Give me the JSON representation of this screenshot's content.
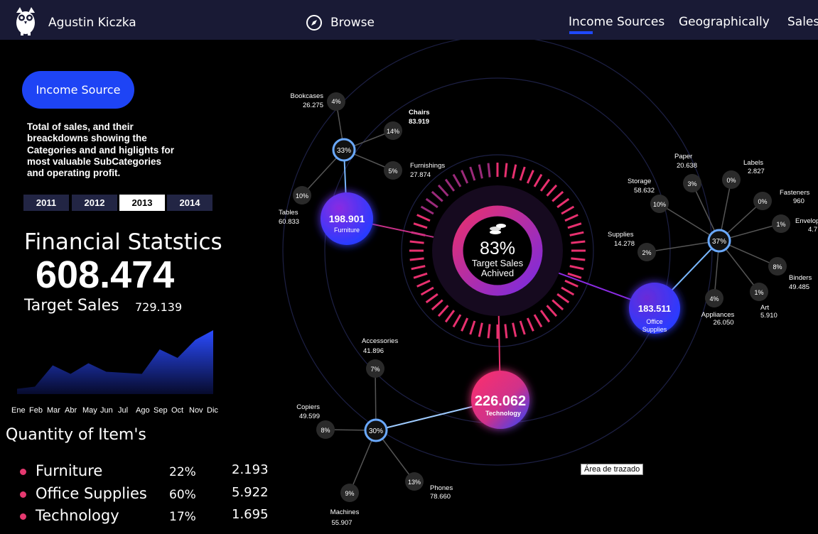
{
  "header": {
    "user_name": "Agustin Kiczka",
    "browse_label": "Browse",
    "nav": [
      {
        "label": "Income Sources",
        "active": true
      },
      {
        "label": "Geographically",
        "active": false
      },
      {
        "label": "Sales",
        "active": false
      }
    ]
  },
  "sidebar": {
    "pill_label": "Income Source",
    "description": "Total of sales, and their\nbreackdowns showing the\nCategories and and higlights for\nmost valuable SubCategories\nand operating profit.",
    "years": [
      {
        "label": "2011",
        "active": false
      },
      {
        "label": "2012",
        "active": false
      },
      {
        "label": "2013",
        "active": true
      },
      {
        "label": "2014",
        "active": false
      }
    ],
    "fin_title": "Financial Statstics",
    "total": "608.474",
    "target_label": "Target Sales",
    "target_value": "729.139",
    "months": [
      "Ene",
      "Feb",
      "Mar",
      "Abr",
      "May",
      "Jun",
      "Jul",
      "Ago",
      "Sep",
      "Oct",
      "Nov",
      "Dic"
    ],
    "qty_title": "Quantity of Item's",
    "quantities": [
      {
        "name": "Furniture",
        "pct": "22%",
        "value": "2.193"
      },
      {
        "name": "Office Supplies",
        "pct": "60%",
        "value": "5.922"
      },
      {
        "name": "Technology",
        "pct": "17%",
        "value": "1.695"
      }
    ]
  },
  "monthly_trend": [
    0.05,
    0.07,
    0.27,
    0.19,
    0.29,
    0.21,
    0.2,
    0.19,
    0.42,
    0.34,
    0.51,
    0.6
  ],
  "center": {
    "percent": "83%",
    "label1": "Target Sales",
    "label2": "Achived",
    "achieved_fraction": 0.83
  },
  "categories": [
    {
      "name": "Furniture",
      "value": "198.901",
      "hub_pct": "33%",
      "subs": [
        {
          "name": "Bookcases",
          "value": "26.275",
          "pct": "4%"
        },
        {
          "name": "Chairs",
          "value": "83.919",
          "pct": "14%"
        },
        {
          "name": "Furnishings",
          "value": "27.874",
          "pct": "5%"
        },
        {
          "name": "Tables",
          "value": "60.833",
          "pct": "10%"
        }
      ]
    },
    {
      "name_line1": "Office",
      "name_line2": "Supplies",
      "value": "183.511",
      "hub_pct": "37%",
      "subs": [
        {
          "name": "Paper",
          "value": "20.638",
          "pct": "3%"
        },
        {
          "name": "Labels",
          "value": "2.827",
          "pct": "0%"
        },
        {
          "name": "Fasteners",
          "value": "960",
          "pct": "0%"
        },
        {
          "name": "Envelopes",
          "value": "4.7",
          "pct": "1%"
        },
        {
          "name": "Binders",
          "value": "49.485",
          "pct": "8%"
        },
        {
          "name": "Art",
          "value": "5.910",
          "pct": "1%"
        },
        {
          "name": "Appliances",
          "value": "26.050",
          "pct": "4%"
        },
        {
          "name": "Supplies",
          "value": "14.278",
          "pct": "2%"
        },
        {
          "name": "Storage",
          "value": "58.632",
          "pct": "10%"
        }
      ]
    },
    {
      "name": "Technology",
      "value": "226.062",
      "hub_pct": "30%",
      "subs": [
        {
          "name": "Accessories",
          "value": "41.896",
          "pct": "7%"
        },
        {
          "name": "Copiers",
          "value": "49.599",
          "pct": "8%"
        },
        {
          "name": "Machines",
          "value": "55.907",
          "pct": "9%"
        },
        {
          "name": "Phones",
          "value": "78.660",
          "pct": "13%"
        }
      ]
    }
  ],
  "tooltip": "Área de trazado",
  "colors": {
    "accent": "#1f49ff",
    "pink": "#e53970",
    "purple": "#8a2be2",
    "topbar": "#191a35"
  }
}
